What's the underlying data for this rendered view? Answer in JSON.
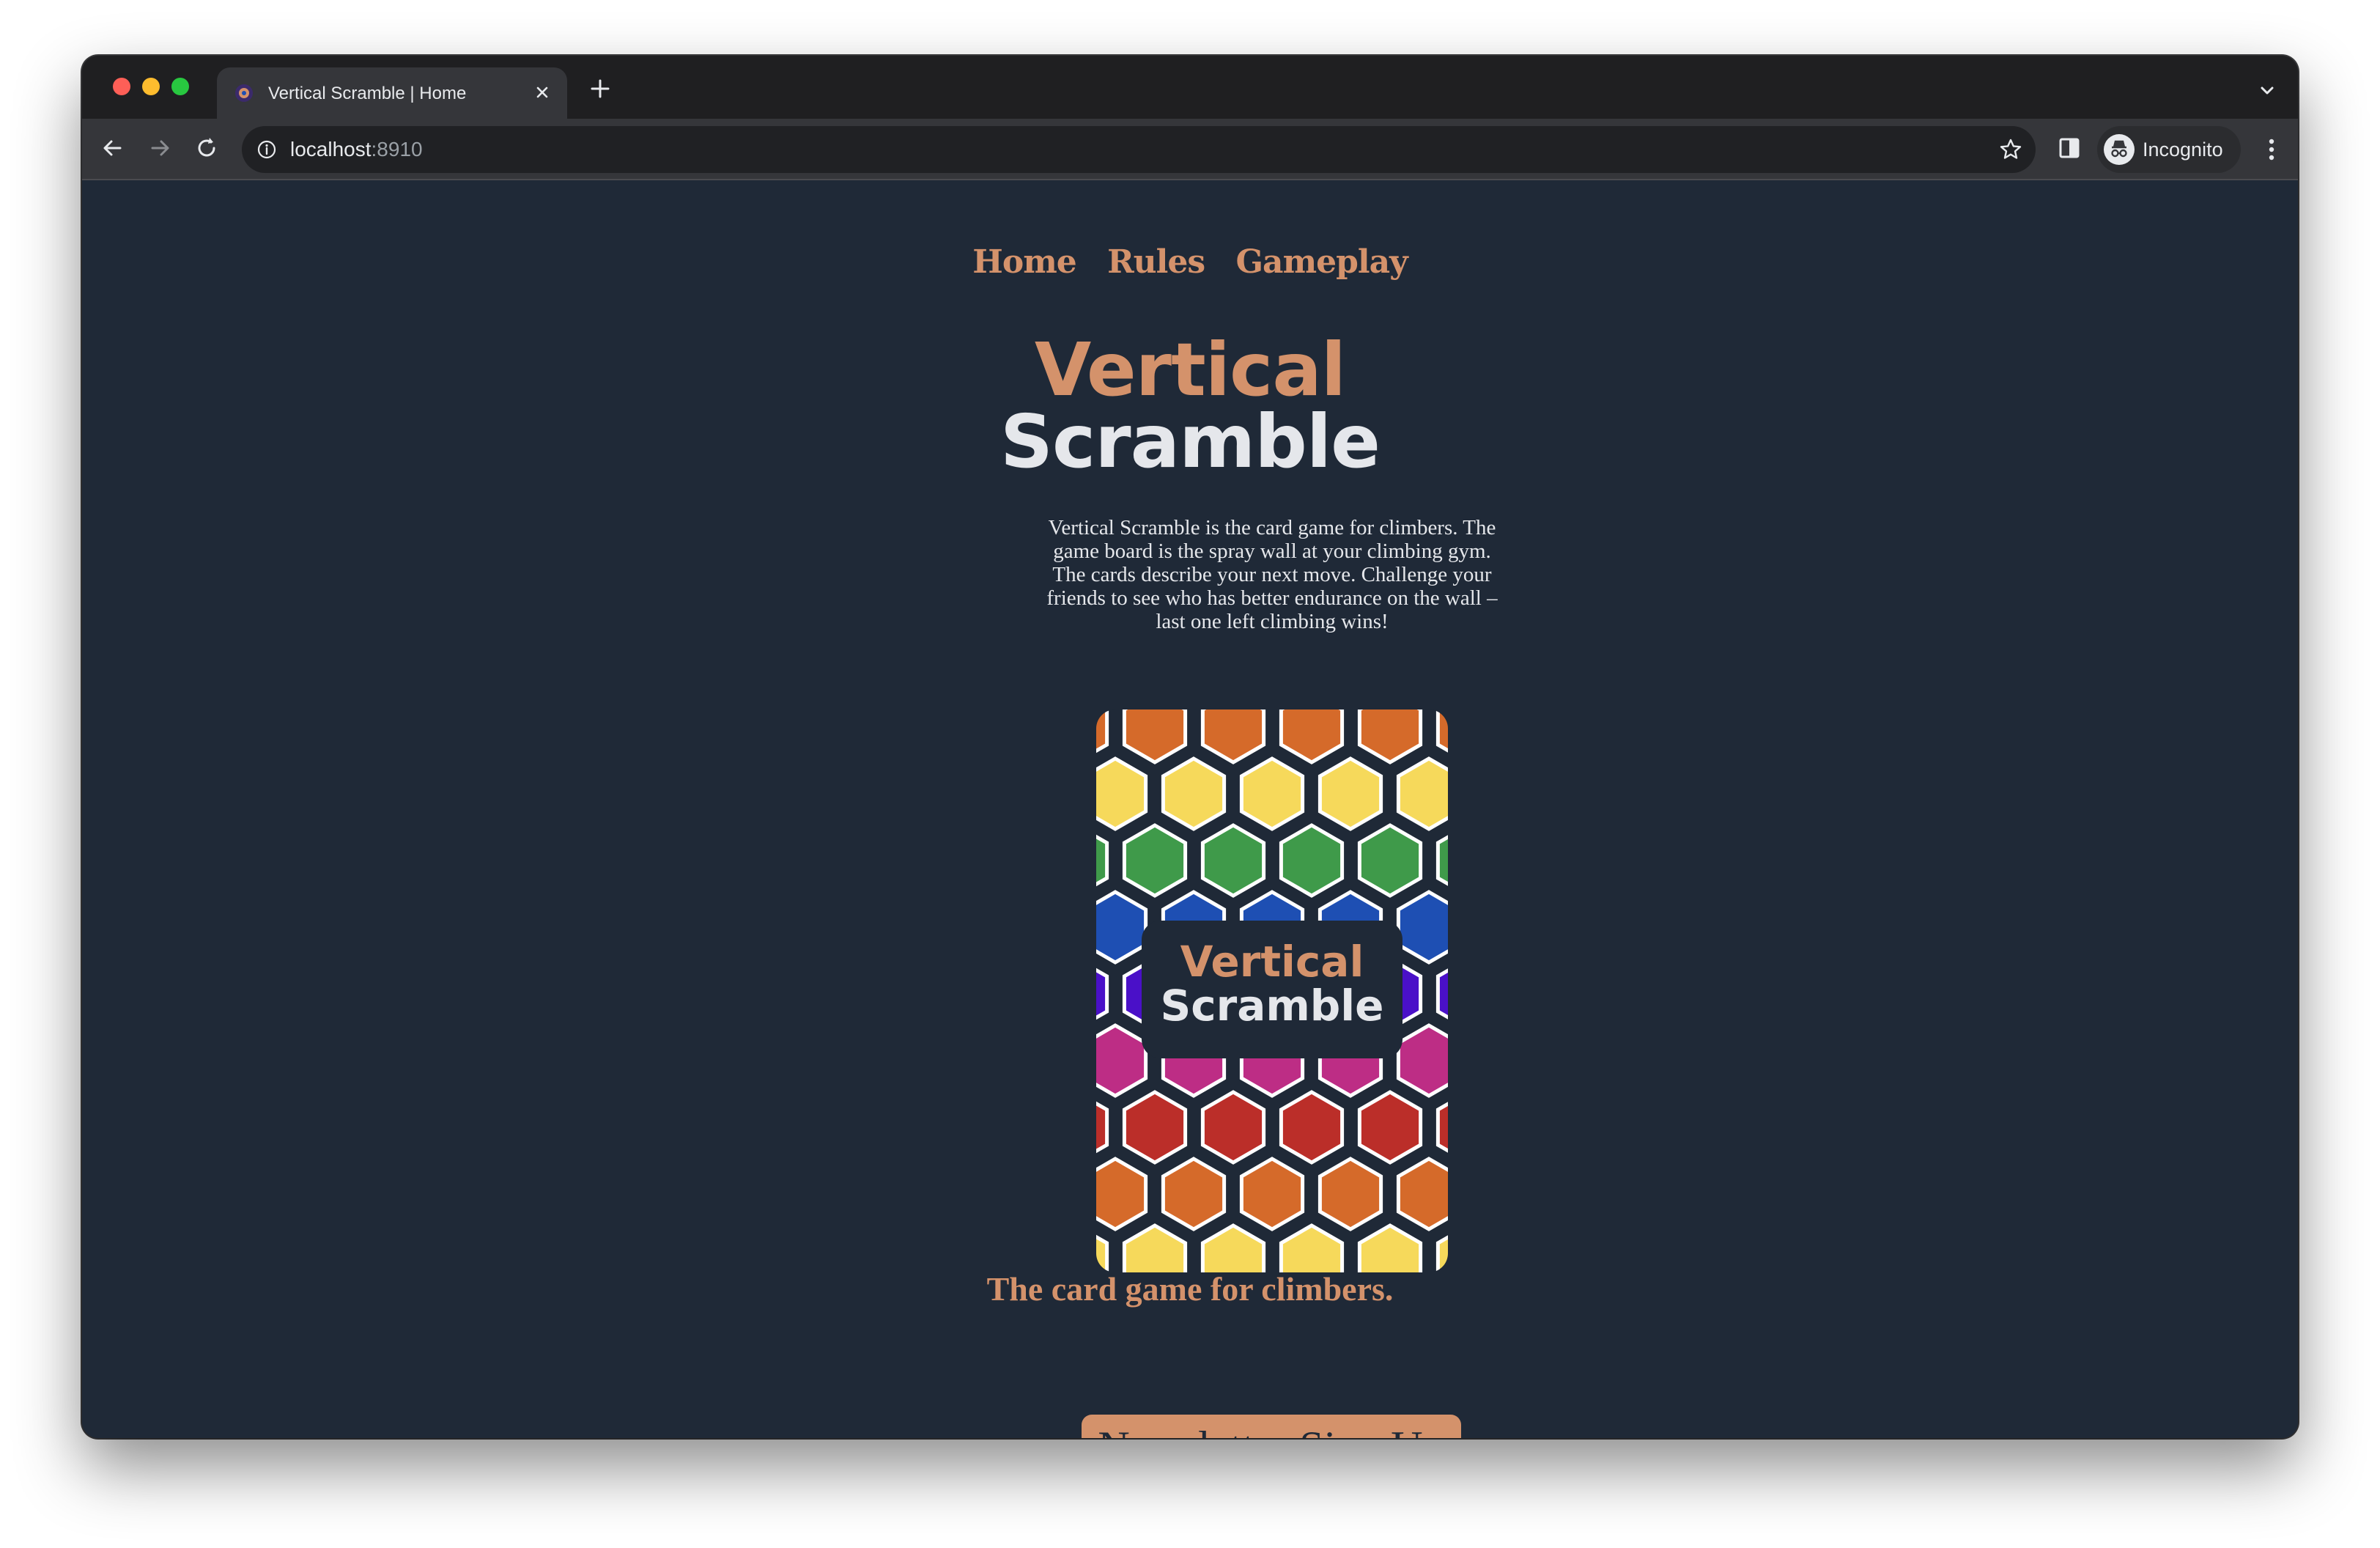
{
  "browser": {
    "tab_title": "Vertical Scramble | Home",
    "url_host": "localhost",
    "url_port": ":8910",
    "profile_label": "Incognito",
    "icons": [
      "back-arrow-icon",
      "forward-arrow-icon",
      "reload-icon",
      "info-icon",
      "bookmark-star-icon",
      "side-panel-icon",
      "incognito-icon",
      "more-menu-icon",
      "close-icon",
      "plus-icon",
      "chevron-down-icon"
    ]
  },
  "site": {
    "nav": [
      "Home",
      "Rules",
      "Gameplay"
    ],
    "title_line1": "Vertical",
    "title_line2": "Scramble",
    "blurb": "Vertical Scramble is the card game for climbers. The game board is the spray wall at your climbing gym. The cards describe your next move. Challenge your friends to see who has better endurance on the wall – last one left climbing wins!",
    "card_line1": "Vertical",
    "card_line2": "Scramble",
    "tagline": "The card game for climbers.",
    "signup_label": "Newsletter Sign Up"
  },
  "colors": {
    "accent": "#d4926b",
    "background": "#1f2937",
    "hex_rows": [
      "#d56a2a",
      "#f6d95b",
      "#3f9a4a",
      "#1e4fb3",
      "#4a10c8",
      "#bd2d85",
      "#bb2e29",
      "#d56a2a",
      "#f6d95b"
    ]
  }
}
